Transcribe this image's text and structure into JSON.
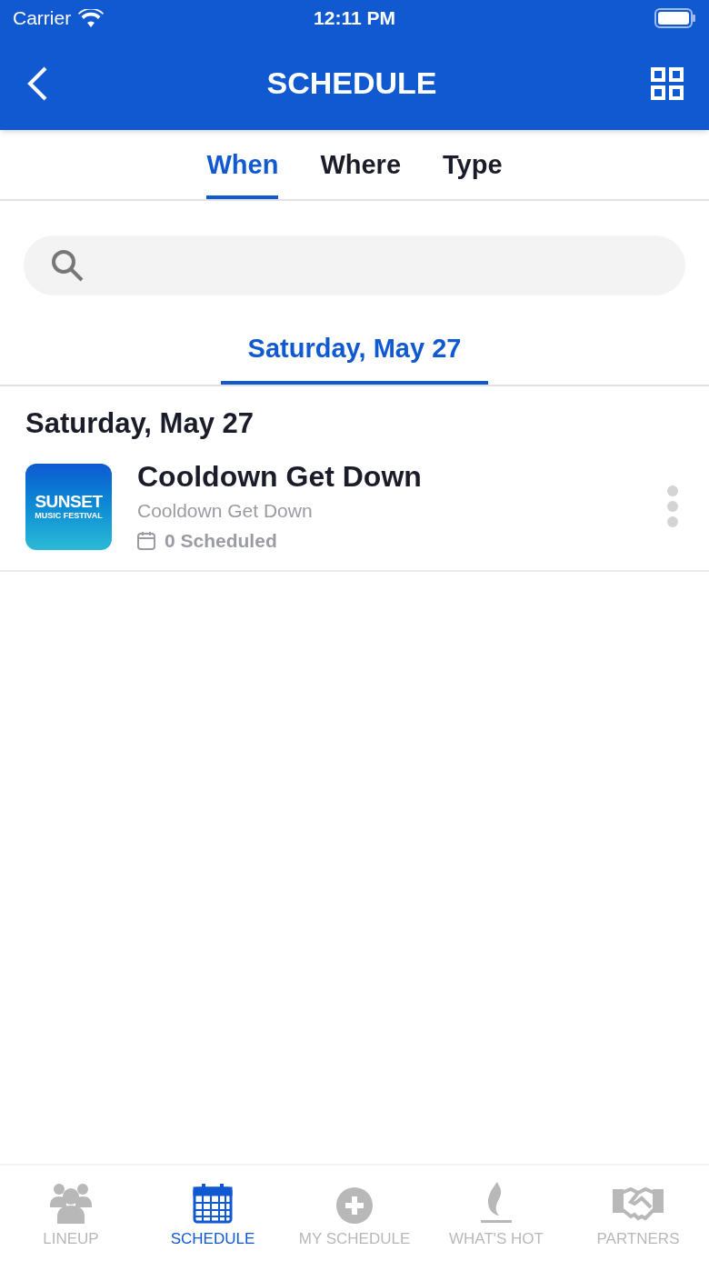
{
  "status_bar": {
    "carrier": "Carrier",
    "time": "12:11 PM"
  },
  "nav_bar": {
    "title": "SCHEDULE"
  },
  "tabs": [
    {
      "label": "When",
      "selected": true
    },
    {
      "label": "Where",
      "selected": false
    },
    {
      "label": "Type",
      "selected": false
    }
  ],
  "date_tabs": [
    {
      "label": "Saturday, May 27",
      "selected": true
    }
  ],
  "sections": [
    {
      "heading": "Saturday, May 27",
      "events": [
        {
          "title": "Cooldown Get Down",
          "subtitle": "Cooldown Get Down",
          "scheduled": "0 Scheduled",
          "logo": {
            "line_1": "SUNSET",
            "line_2": "MUSIC FESTIVAL"
          }
        }
      ]
    }
  ],
  "bottom_tabs": [
    {
      "kind": "people",
      "label": "LINEUP",
      "selected": false
    },
    {
      "kind": "calendar",
      "label": "SCHEDULE",
      "selected": true
    },
    {
      "kind": "plus",
      "label": "MY SCHEDULE",
      "selected": false
    },
    {
      "kind": "flame",
      "label": "WHAT'S HOT",
      "selected": false
    },
    {
      "kind": "handshake",
      "label": "PARTNERS",
      "selected": false
    }
  ]
}
